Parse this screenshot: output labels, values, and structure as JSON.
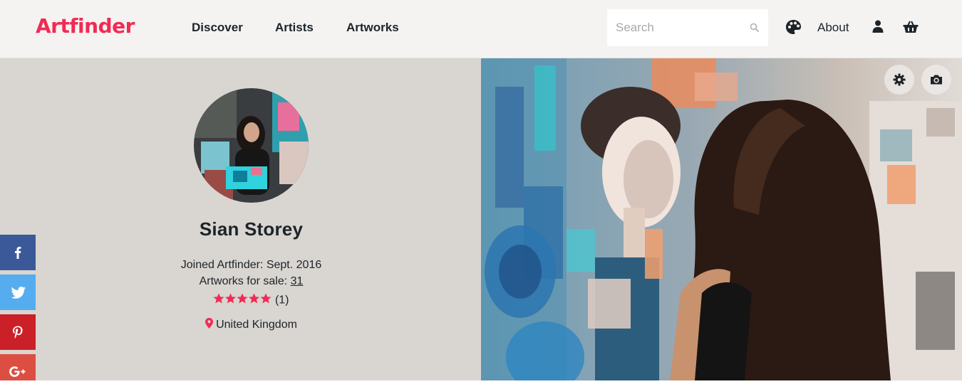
{
  "brand": {
    "name": "Artfinder",
    "color": "#f12b55"
  },
  "nav": {
    "discover": "Discover",
    "artists": "Artists",
    "artworks": "Artworks",
    "about": "About"
  },
  "search": {
    "placeholder": "Search",
    "value": ""
  },
  "profile": {
    "name": "Sian Storey",
    "joined": "Joined Artfinder: Sept. 2016",
    "artworks_label": "Artworks for sale: ",
    "artworks_count": "31",
    "rating_stars": 5,
    "review_count": "(1)",
    "location": "United Kingdom"
  },
  "icons": {
    "header": [
      "palette-icon",
      "user-icon",
      "basket-icon",
      "search-icon"
    ],
    "hero": [
      "gear-icon",
      "camera-icon"
    ],
    "social": [
      "facebook-icon",
      "twitter-icon",
      "pinterest-icon",
      "google-plus-icon"
    ]
  },
  "colors": {
    "facebook": "#3b5998",
    "twitter": "#55acee",
    "pinterest": "#cb2027",
    "googleplus": "#dc4e41",
    "star": "#f12b55",
    "panel": "#d9d5d0"
  }
}
